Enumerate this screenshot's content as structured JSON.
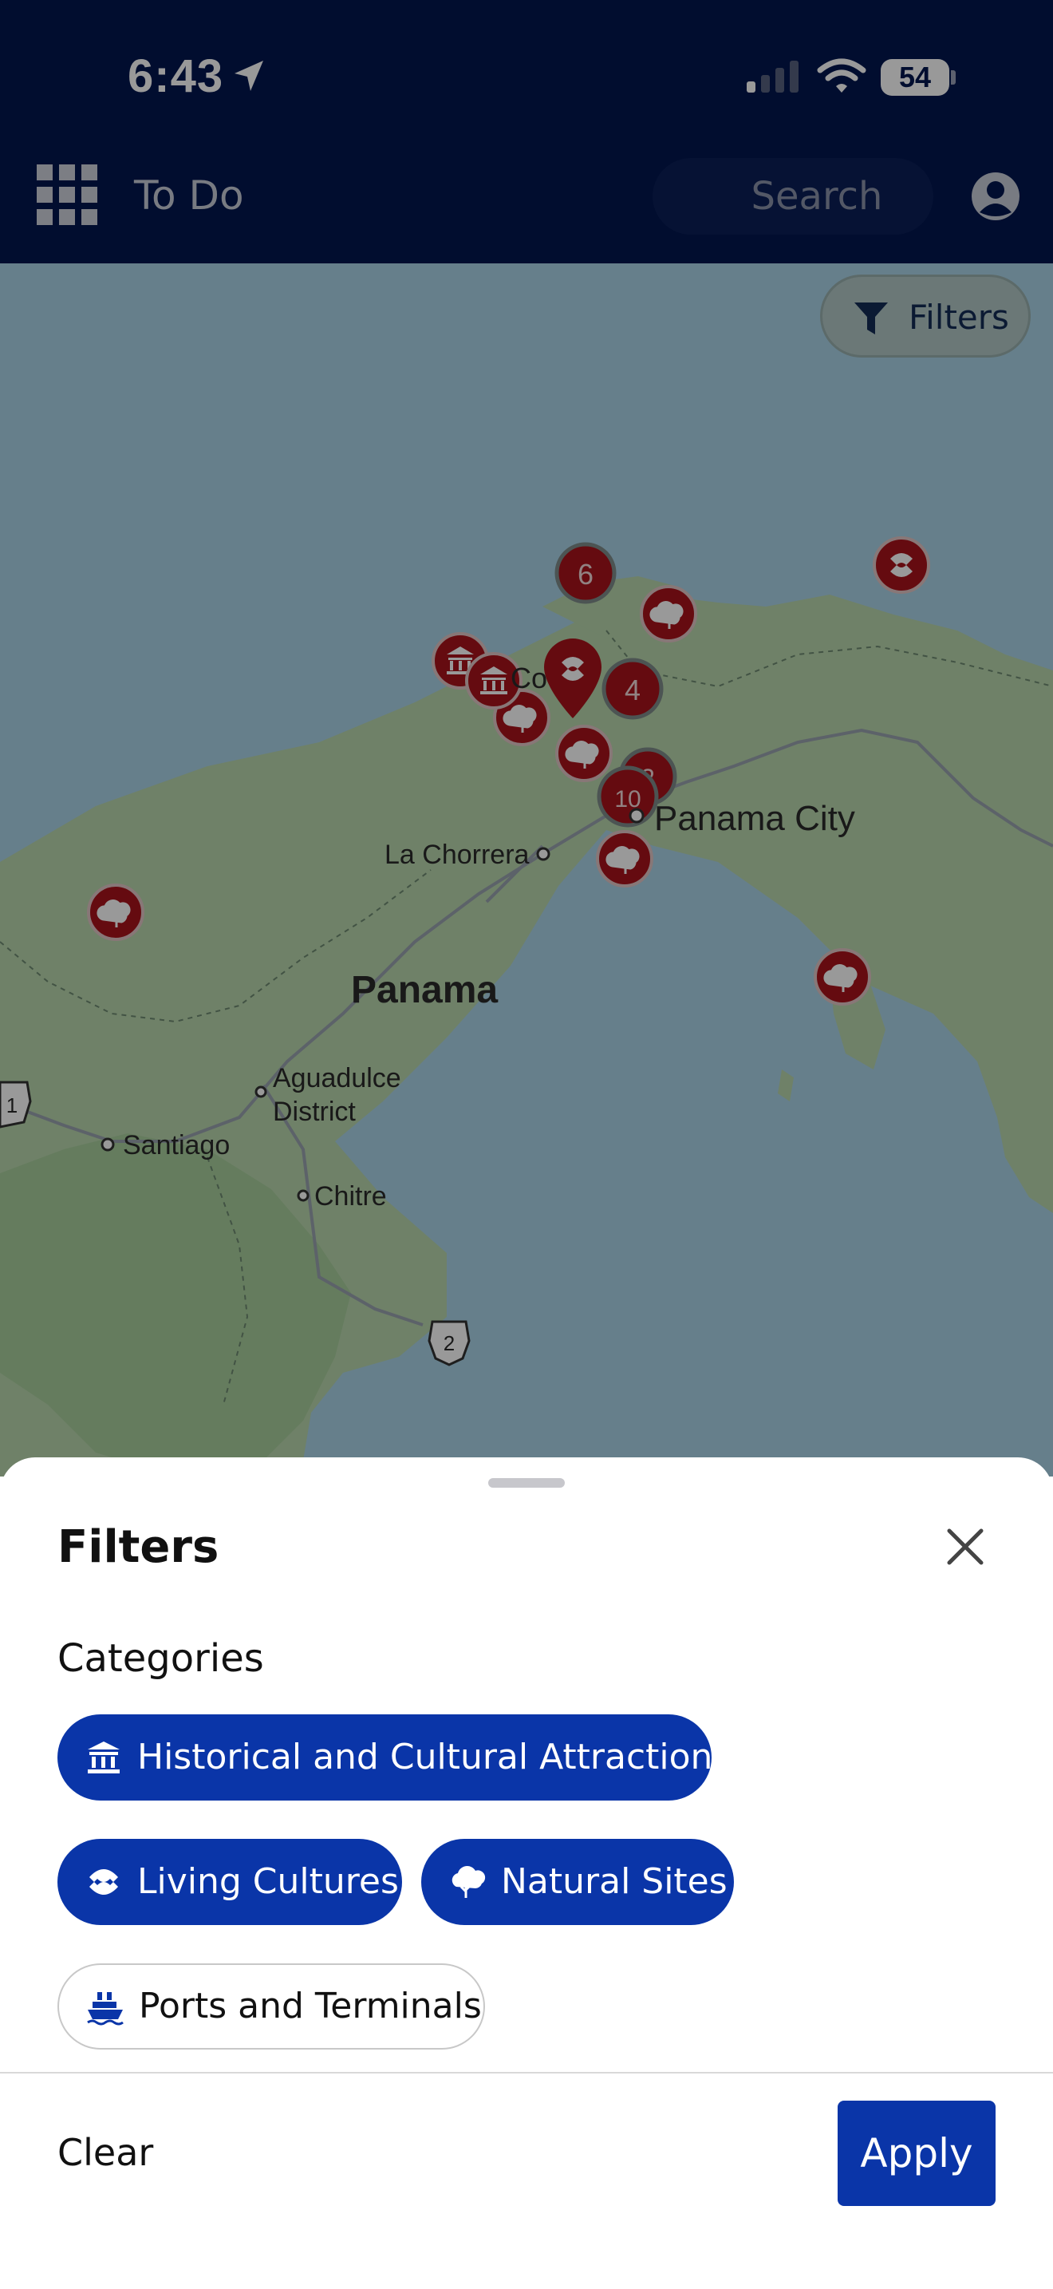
{
  "status_bar": {
    "time": "6:43",
    "battery": "54"
  },
  "nav": {
    "title": "To Do",
    "search_placeholder": "Search"
  },
  "map": {
    "filters_button": "Filters",
    "labels": {
      "panama_city": "Panama City",
      "la_chorrera": "La Chorrera",
      "panama": "Panama",
      "aguadulce_1": "Aguadulce",
      "aguadulce_2": "District",
      "santiago": "Santiago",
      "chitre": "Chitre",
      "colon_partial": "Co",
      "route_1": "1",
      "route_2": "2"
    },
    "clusters": [
      "6",
      "4",
      "10",
      "2"
    ]
  },
  "sheet": {
    "title": "Filters",
    "section": "Categories",
    "chips": [
      {
        "label": "Historical and Cultural Attractions",
        "selected": true,
        "icon": "museum-icon"
      },
      {
        "label": "Living Cultures",
        "selected": true,
        "icon": "living-cultures-icon"
      },
      {
        "label": "Natural Sites",
        "selected": true,
        "icon": "tree-icon"
      },
      {
        "label": "Ports and Terminals",
        "selected": false,
        "icon": "ship-icon"
      }
    ],
    "clear": "Clear",
    "apply": "Apply"
  },
  "colors": {
    "header": "#02164f",
    "accent": "#0a35a8",
    "marker": "#a8131b",
    "overlay": "rgba(0,0,0,0.4)"
  }
}
